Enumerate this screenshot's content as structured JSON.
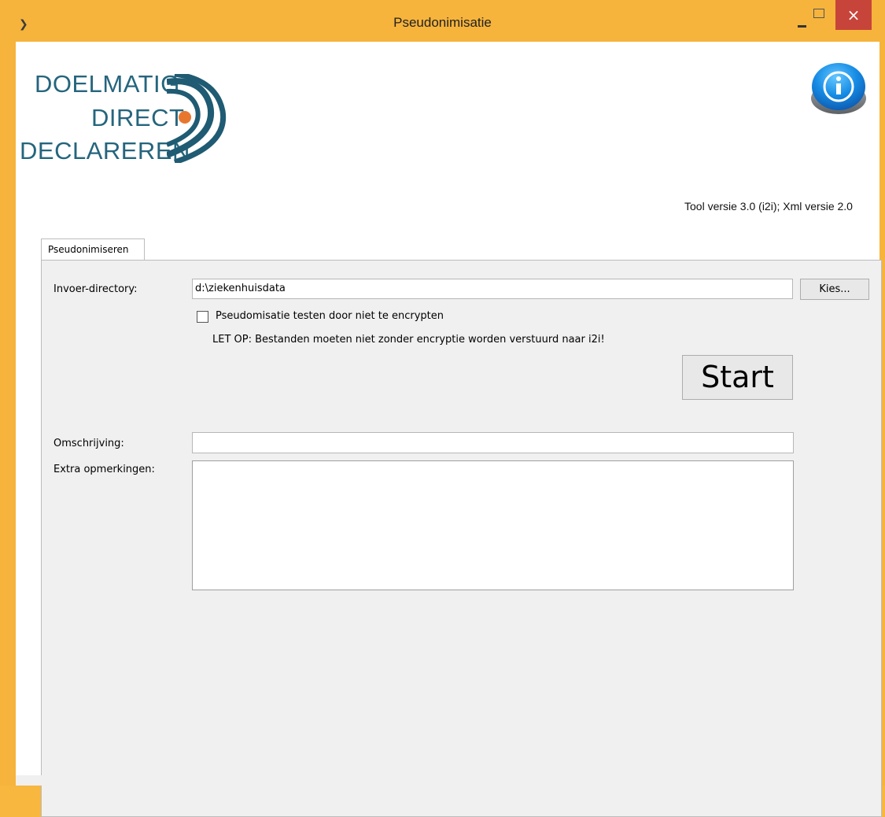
{
  "window": {
    "title": "Pseudonimisatie",
    "minimize_icon": "minimize-icon",
    "maximize_icon": "maximize-icon",
    "close_label": "×"
  },
  "logo": {
    "line1": "DOELMATIG",
    "line2": "DIRECT",
    "line3": "DECLAREREN",
    "accent_color": "#e8772e",
    "brand_color": "#25657d"
  },
  "header": {
    "version_text": "Tool versie 3.0 (i2i); Xml versie 2.0",
    "info_icon": "info-icon"
  },
  "tabs": [
    {
      "label": "Pseudonimiseren",
      "active": true
    }
  ],
  "form": {
    "input_dir_label": "Invoer-directory:",
    "input_dir_value": "d:\\ziekenhuisdata",
    "choose_button": "Kies...",
    "test_checkbox_label": "Pseudomisatie testen door niet te encrypten",
    "test_checkbox_checked": false,
    "warning": "LET OP: Bestanden moeten niet zonder encryptie worden verstuurd naar i2i!",
    "start_button": "Start",
    "description_label": "Omschrijving:",
    "description_value": "",
    "remarks_label": "Extra opmerkingen:",
    "remarks_value": ""
  }
}
